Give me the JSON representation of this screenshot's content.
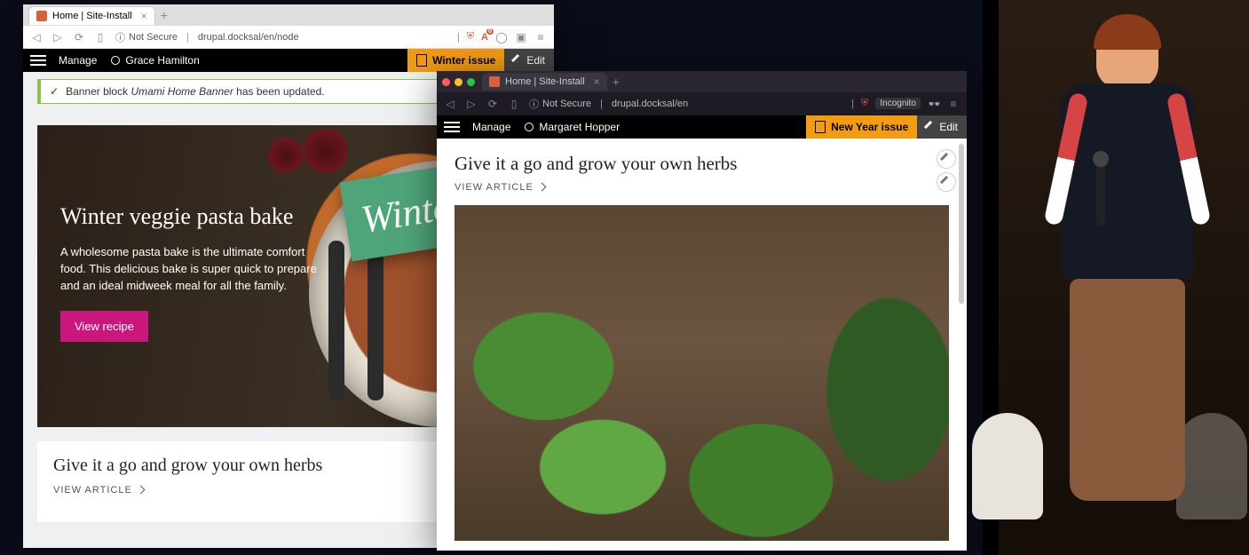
{
  "left_browser": {
    "tab_title": "Home | Site-Install",
    "nav_back": "◁",
    "nav_fwd": "▷",
    "nav_reload": "⟳",
    "security_label": "Not Secure",
    "url": "drupal.docksal/en/node",
    "ext_brave": "⛨",
    "ext_a_label": "A",
    "ext_a_count": "0",
    "manage_label": "Manage",
    "user_name": "Grace Hamilton",
    "issue_label": "Winter issue",
    "edit_label": "Edit",
    "notice_prefix": "Banner block",
    "notice_em": "Umami Home Banner",
    "notice_suffix": "has been updated.",
    "hero_title": "Winter veggie pasta bake",
    "hero_body": "A wholesome pasta bake is the ultimate comfort food. This delicious bake is super quick to prepare and an ideal midweek meal for all the family.",
    "view_recipe": "View recipe",
    "winter_badge": "Winter",
    "article2_title": "Give it a go and grow your own herbs",
    "article2_link": "VIEW ARTICLE"
  },
  "right_browser": {
    "tab_title": "Home | Site-Install",
    "security_label": "Not Secure",
    "url": "drupal.docksal/en",
    "incognito_label": "Incognito",
    "manage_label": "Manage",
    "user_name": "Margaret Hopper",
    "issue_label": "New Year issue",
    "edit_label": "Edit",
    "article_title": "Give it a go and grow your own herbs",
    "article_link": "VIEW ARTICLE"
  }
}
